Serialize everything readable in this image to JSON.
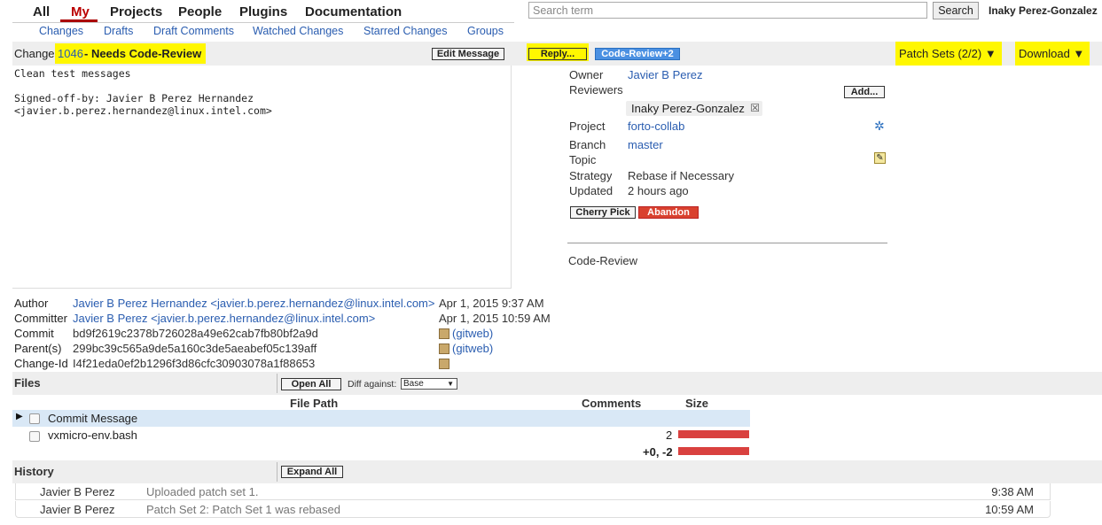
{
  "topnav": {
    "items": [
      "All",
      "My",
      "Projects",
      "People",
      "Plugins",
      "Documentation"
    ],
    "subitems": [
      "Changes",
      "Drafts",
      "Draft Comments",
      "Watched Changes",
      "Starred Changes",
      "Groups"
    ]
  },
  "search": {
    "placeholder": "Search term",
    "button": "Search"
  },
  "user": {
    "name": "Inaky Perez-Gonzalez"
  },
  "change": {
    "prefix": "Change",
    "number": "1046",
    "status": "- Needs Code-Review",
    "edit_message": "Edit Message",
    "reply": "Reply...",
    "label_badge": "Code-Review+2",
    "patch_sets": "Patch Sets (2/2) ▼",
    "download": "Download ▼",
    "message_title": "Clean test messages",
    "message_signoff": "Signed-off-by: Javier B Perez Hernandez <javier.b.perez.hernandez@linux.intel.com>"
  },
  "info": {
    "owner_label": "Owner",
    "owner": "Javier B Perez",
    "reviewers_label": "Reviewers",
    "add_button": "Add...",
    "reviewer": "Inaky Perez-Gonzalez",
    "project_label": "Project",
    "project": "forto-collab",
    "branch_label": "Branch",
    "branch": "master",
    "topic_label": "Topic",
    "strategy_label": "Strategy",
    "strategy": "Rebase if Necessary",
    "updated_label": "Updated",
    "updated": "2 hours ago",
    "cherry_pick": "Cherry Pick",
    "abandon": "Abandon",
    "code_review": "Code-Review"
  },
  "meta": {
    "author_label": "Author",
    "author": "Javier B Perez Hernandez <javier.b.perez.hernandez@linux.intel.com>",
    "author_date": "Apr 1, 2015 9:37 AM",
    "committer_label": "Committer",
    "committer": "Javier B Perez <javier.b.perez.hernandez@linux.intel.com>",
    "committer_date": "Apr 1, 2015 10:59 AM",
    "commit_label": "Commit",
    "commit": "bd9f2619c2378b726028a49e62cab7fb80bf2a9d",
    "parent_label": "Parent(s)",
    "parent": "299bc39c565a9de5a160c3de5aeabef05c139aff",
    "changeid_label": "Change-Id",
    "changeid": "I4f21eda0ef2b1296f3d86cfc30903078a1f88653",
    "gitweb": "(gitweb)"
  },
  "files": {
    "title": "Files",
    "open_all": "Open All",
    "diff_against": "Diff against:",
    "diff_base": "Base",
    "col_path": "File Path",
    "col_comments": "Comments",
    "col_size": "Size",
    "rows": [
      {
        "name": "Commit Message",
        "comments": "",
        "size_fraction": 0
      },
      {
        "name": "vxmicro-env.bash",
        "comments": "2",
        "size_fraction": 1
      }
    ],
    "total_delta": "+0, -2"
  },
  "history": {
    "title": "History",
    "expand_all": "Expand All",
    "rows": [
      {
        "who": "Javier B Perez",
        "what": "Uploaded patch set 1.",
        "when": "9:38 AM"
      },
      {
        "who": "Javier B Perez",
        "what": "Patch Set 2: Patch Set 1 was rebased",
        "when": "10:59 AM"
      }
    ]
  },
  "colors": {
    "link": "#2a5db0",
    "highlight": "#fff700",
    "badge_blue": "#4a90e2",
    "abandon_red": "#d9412f",
    "size_bar": "#d9413f"
  }
}
